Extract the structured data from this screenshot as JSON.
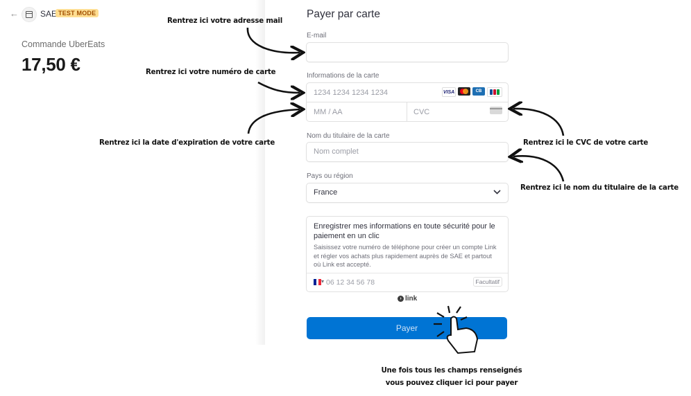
{
  "header": {
    "back_label": "←",
    "merchant_name": "SAE",
    "test_mode_badge": "TEST MODE"
  },
  "order": {
    "label": "Commande UberEats",
    "amount": "17,50 €"
  },
  "form": {
    "title": "Payer par carte",
    "email_label": "E-mail",
    "card_info_label": "Informations de la carte",
    "card_number_placeholder": "1234 1234 1234 1234",
    "expiry_placeholder": "MM / AA",
    "cvc_placeholder": "CVC",
    "card_logos": [
      "VISA",
      "Mastercard",
      "CB",
      "JCB"
    ],
    "holder_label": "Nom du titulaire de la carte",
    "holder_placeholder": "Nom complet",
    "country_label": "Pays ou région",
    "country_value": "France",
    "link_title": "Enregistrer mes informations en toute sécurité pour le paiement en un clic",
    "link_description": "Saisissez votre numéro de téléphone pour créer un compte Link et régler vos achats plus rapidement auprès de SAE et partout où Link est accepté.",
    "phone_placeholder": "06 12 34 56 78",
    "optional_badge": "Facultatif",
    "link_brand": "link",
    "pay_button": "Payer"
  },
  "annotations": {
    "email": "Rentrez ici votre adresse mail",
    "card_number": "Rentrez ici votre numéro de carte",
    "expiry": "Rentrez ici la date d'expiration de votre carte",
    "cvc": "Rentrez ici le CVC de votre carte",
    "holder": "Rentrez ici le nom du titulaire de la carte",
    "pay_line1": "Une fois tous les champs renseignés",
    "pay_line2": "vous pouvez cliquer ici pour payer"
  },
  "colors": {
    "accent": "#0074d4",
    "badge_bg": "#ffde92",
    "badge_text": "#a04e00"
  },
  "icons": [
    "back-arrow-icon",
    "merchant-icon",
    "card-brand-logos",
    "cvc-card-icon",
    "chevron-down-icon",
    "france-flag-icon",
    "link-logo-icon",
    "pointer-hand-icon"
  ]
}
